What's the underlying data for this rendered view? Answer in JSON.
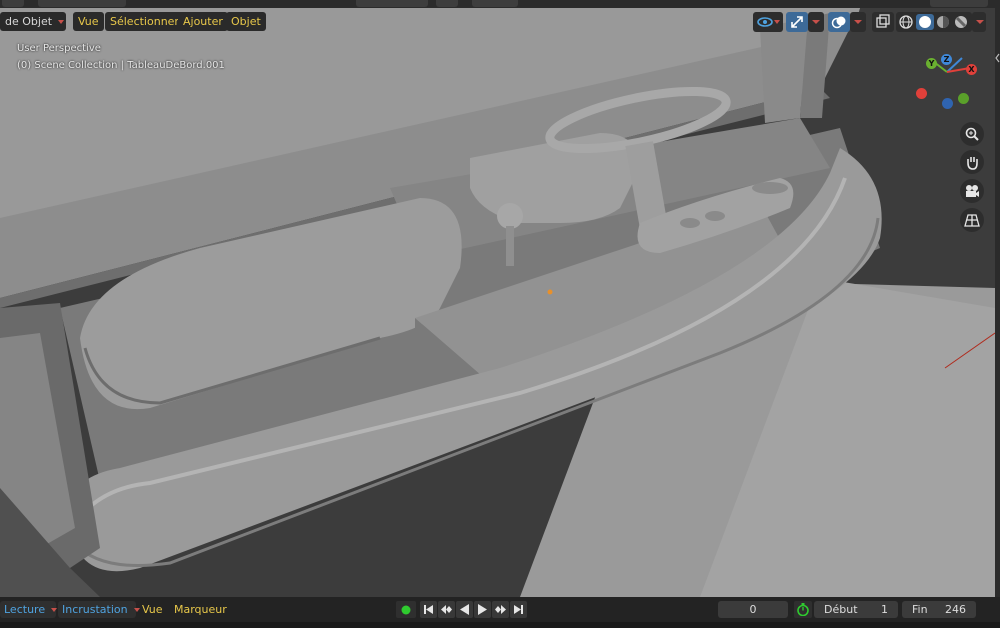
{
  "header": {
    "mode_label": "de Objet",
    "menus": [
      "Vue",
      "Sélectionner",
      "Ajouter",
      "Objet"
    ]
  },
  "overlay": {
    "perspective": "User Perspective",
    "collection": "(0) Scene Collection | TableauDeBord.001"
  },
  "gizmo": {
    "x": "X",
    "y": "Y",
    "z": "Z"
  },
  "nav_icons": [
    "zoom-icon",
    "hand-pan-icon",
    "camera-icon",
    "grid-perspective-icon"
  ],
  "timeline": {
    "playback_label": "Lecture",
    "keying_label": "Incrustation",
    "view_label": "Vue",
    "marker_label": "Marqueur",
    "current_frame": "0",
    "start_label": "Début",
    "start_value": "1",
    "end_label": "Fin",
    "end_value": "246"
  },
  "colors": {
    "accent_blue": "#3d6a98",
    "menu_text": "#e8c84a",
    "axis_x": "#e0403a",
    "axis_y": "#6ab030",
    "axis_z": "#3f88d8",
    "record": "#2fcb2f"
  }
}
